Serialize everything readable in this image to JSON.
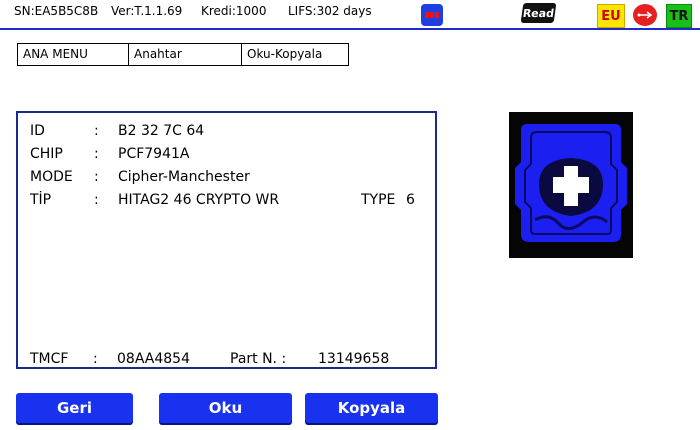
{
  "status": {
    "serial": "SN:EA5B5C8B",
    "version": "Ver:T.1.1.69",
    "credits": "Kredi:1000",
    "life": "LIFS:302 days",
    "read_icon_label": "Read",
    "eu_icon_label": "EU",
    "tr_icon_label": "TR",
    "icons": [
      "bitmap-icon",
      "read-icon",
      "eu-flag-icon",
      "usb-icon",
      "tr-flag-icon"
    ]
  },
  "breadcrumb": [
    "ANA MENU",
    "Anahtar",
    "Oku-Kopyala"
  ],
  "info": {
    "rows": [
      {
        "key": "ID",
        "value": "B2 32 7C 64"
      },
      {
        "key": "CHIP",
        "value": "PCF7941A"
      },
      {
        "key": "MODE",
        "value": "Cipher-Manchester"
      },
      {
        "key": "TİP",
        "value": "HITAG2 46 CRYPTO WR"
      }
    ],
    "separator": ":",
    "type_label": "TYPE",
    "type_value": "6",
    "tmcf_label": "TMCF",
    "tmcf_value": "08AA4854",
    "part_label": "Part N. :",
    "part_value": "13149658"
  },
  "buttons": {
    "back": "Geri",
    "read": "Oku",
    "copy": "Kopyala"
  },
  "colors": {
    "accent": "#1832f0",
    "panel_border": "#1a2a90",
    "key_fill": "#1b1ff0"
  }
}
